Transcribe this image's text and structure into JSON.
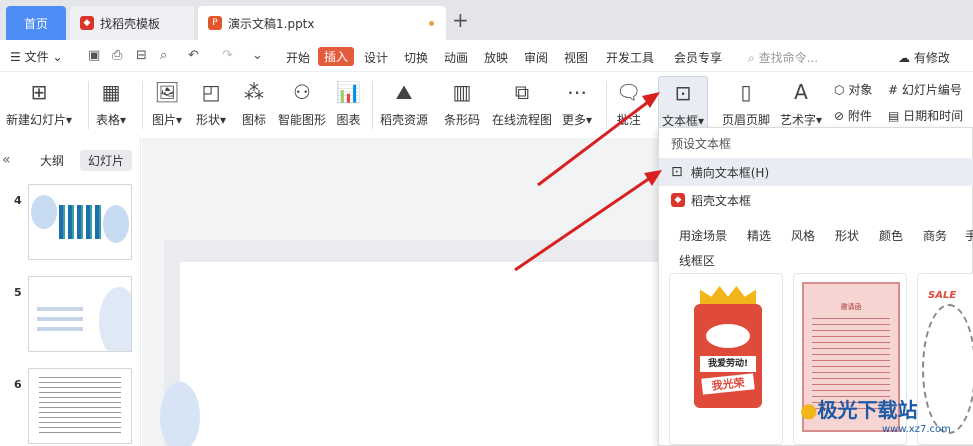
{
  "titlebar": {
    "home_tab": "首页",
    "template_tab": "找稻壳模板",
    "doc_tab": "演示文稿1.pptx",
    "new_tab_icon": "plus-icon"
  },
  "menubar": {
    "file": "文件",
    "tabs": [
      "开始",
      "插入",
      "设计",
      "切换",
      "动画",
      "放映",
      "审阅",
      "视图",
      "开发工具",
      "会员专享"
    ],
    "search_placeholder": "查找命令...",
    "edit_status": "有修改"
  },
  "ribbon": {
    "new_slide": "新建幻灯片",
    "table": "表格",
    "picture": "图片",
    "shape": "形状",
    "icon": "图标",
    "smart_art": "智能图形",
    "chart": "图表",
    "docer_resource": "稻壳资源",
    "barcode": "条形码",
    "flowchart": "在线流程图",
    "more": "更多",
    "comment": "批注",
    "textbox": "文本框",
    "header_footer": "页眉页脚",
    "wordart": "艺术字",
    "object": "对象",
    "attachment": "附件",
    "slide_number": "幻灯片编号",
    "date_time": "日期和时间"
  },
  "leftpanel": {
    "outline": "大纲",
    "slides": "幻灯片",
    "slide_numbers": [
      "4",
      "5",
      "6"
    ]
  },
  "dropdown": {
    "preset": "预设文本框",
    "horizontal": "横向文本框(H)",
    "docer": "稻壳文本框",
    "filters": [
      "用途场景",
      "精选",
      "风格",
      "形状",
      "颜色",
      "商务",
      "手"
    ],
    "section": "线框区",
    "card1_line1": "我爱劳动!",
    "card1_line2": "我光荣",
    "card2_title": "邀请函",
    "card3_text": "SALE"
  },
  "watermark": {
    "brand": "极光下载站",
    "url": "www.xz7.com"
  },
  "colors": {
    "accent": "#4c8cf5",
    "insert_tab": "#e25c3c",
    "arrow": "#d92020"
  }
}
